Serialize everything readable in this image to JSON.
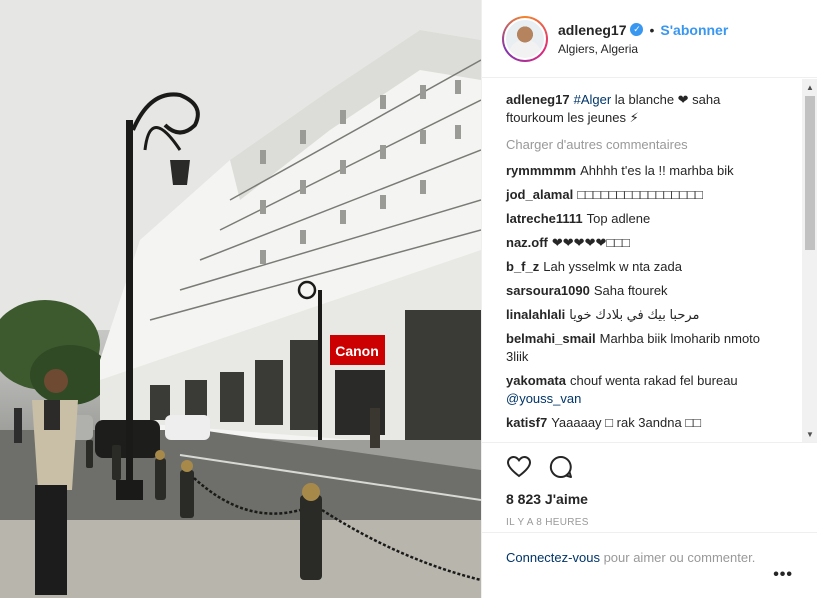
{
  "post": {
    "username": "adleneg17",
    "follow_label": "S'abonner",
    "location": "Algiers, Algeria",
    "separator": "•"
  },
  "caption": {
    "user": "adleneg17",
    "hashtag": "#Alger",
    "text": " la blanche ❤ saha ftourkoum les jeunes ⚡"
  },
  "load_more": "Charger d'autres commentaires",
  "comments": [
    {
      "user": "rymmmmm",
      "text": "Ahhhh t'es la !! marhba bik"
    },
    {
      "user": "jod_alamal",
      "text": "□□□□□□□□□□□□□□□□"
    },
    {
      "user": "latreche1111",
      "text": "Top adlene"
    },
    {
      "user": "naz.off",
      "text": "❤❤❤❤❤□□□"
    },
    {
      "user": "b_f_z",
      "text": "Lah ysselmk w nta zada"
    },
    {
      "user": "sarsoura1090",
      "text": "Saha ftourek"
    },
    {
      "user": "linalahlali",
      "text": "مرحبا بيك في بلادك خويا"
    },
    {
      "user": "belmahi_smail",
      "text": "Marhba biik lmoharib nmoto 3liik"
    },
    {
      "user": "yakomata",
      "text": "chouf wenta rakad fel bureau",
      "mention": "@youss_van"
    },
    {
      "user": "katisf7",
      "text": "Yaaaaay □ rak 3andna □□"
    }
  ],
  "likes": "8 823 J'aime",
  "timestamp": "IL Y A 8 HEURES",
  "login": {
    "link": "Connectez-vous",
    "text": " pour aimer ou commenter."
  },
  "more_label": "•••",
  "photo": {
    "sign_text": "Canon"
  },
  "icons": [
    "heart-icon",
    "comment-icon",
    "verified-icon"
  ],
  "colors": {
    "accent": "#3897f0",
    "link": "#003569",
    "muted": "#999999",
    "canon_red": "#cc0000"
  }
}
